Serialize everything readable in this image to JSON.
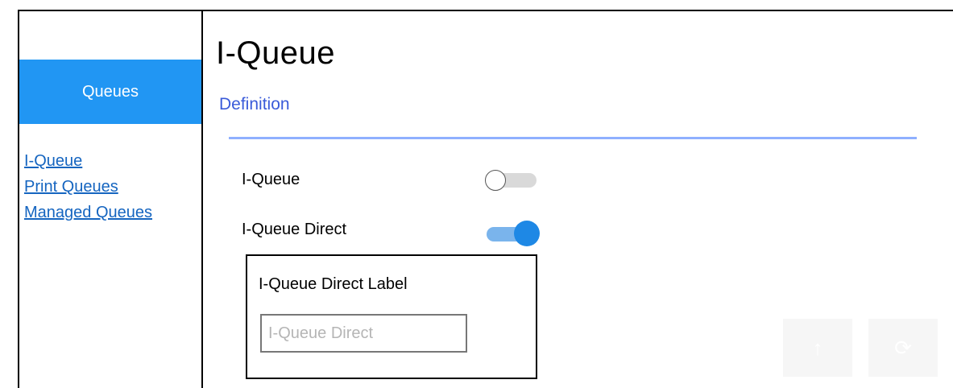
{
  "sidebar": {
    "header_label": "Queues",
    "links": [
      {
        "label": "I-Queue"
      },
      {
        "label": "Print Queues"
      },
      {
        "label": "Managed Queues"
      }
    ]
  },
  "main": {
    "title": "I-Queue",
    "subtitle": "Definition",
    "settings": [
      {
        "label": "I-Queue",
        "state": "off"
      },
      {
        "label": "I-Queue Direct",
        "state": "on"
      }
    ],
    "direct_box": {
      "label": "I-Queue Direct Label",
      "placeholder": "I-Queue Direct"
    }
  },
  "floating_buttons": [
    {
      "icon": "upload-icon"
    },
    {
      "icon": "refresh-icon"
    }
  ],
  "colors": {
    "accent": "#2196f3",
    "link": "#1565c0",
    "divider": "#8fb0ff",
    "toggle_on": "#1e88e5"
  }
}
